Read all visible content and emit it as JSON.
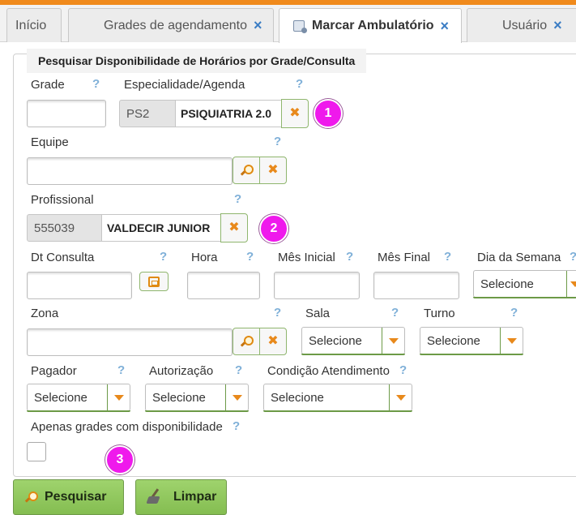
{
  "tabs": [
    {
      "label": "Início",
      "closable": false,
      "active": false
    },
    {
      "label": "Grades de agendamento",
      "closable": true,
      "active": false
    },
    {
      "label": "Marcar Ambulatório",
      "closable": true,
      "active": true,
      "icon": "calendar-page-icon"
    },
    {
      "label": "Usuário",
      "closable": true,
      "active": false
    }
  ],
  "tab_close_glyph": "×",
  "panel": {
    "title": "Pesquisar Disponibilidade de Horários por Grade/Consulta"
  },
  "help_glyph": "?",
  "form": {
    "grade": {
      "label": "Grade",
      "value": ""
    },
    "especialidade": {
      "label": "Especialidade/Agenda",
      "code": "PS2",
      "name": "PSIQUIATRIA 2.0"
    },
    "equipe": {
      "label": "Equipe",
      "value": ""
    },
    "profissional": {
      "label": "Profissional",
      "code": "555039",
      "name": "VALDECIR JUNIOR"
    },
    "dt_consulta": {
      "label": "Dt Consulta",
      "value": ""
    },
    "hora": {
      "label": "Hora",
      "value": ""
    },
    "mes_inicial": {
      "label": "Mês Inicial",
      "value": ""
    },
    "mes_final": {
      "label": "Mês Final",
      "value": ""
    },
    "dia_semana": {
      "label": "Dia da Semana",
      "selected": "Selecione"
    },
    "zona": {
      "label": "Zona",
      "value": ""
    },
    "sala": {
      "label": "Sala",
      "selected": "Selecione"
    },
    "turno": {
      "label": "Turno",
      "selected": "Selecione"
    },
    "pagador": {
      "label": "Pagador",
      "selected": "Selecione"
    },
    "autorizacao": {
      "label": "Autorização",
      "selected": "Selecione"
    },
    "condicao": {
      "label": "Condição Atendimento",
      "selected": "Selecione"
    },
    "apenas_grades": {
      "label": "Apenas grades com disponibilidade",
      "checked": false
    }
  },
  "badges": [
    "1",
    "2",
    "3"
  ],
  "badge_color": "#ef19ec",
  "accent_color": "#f08a1c",
  "buttons": {
    "pesquisar": "Pesquisar",
    "limpar": "Limpar"
  },
  "clear_glyph": "✖"
}
